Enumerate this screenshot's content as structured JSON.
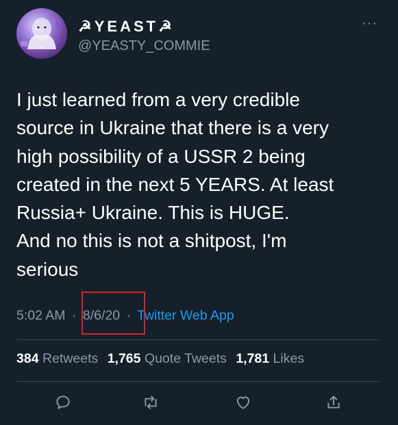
{
  "author": {
    "display_name": "☭YEAST☭",
    "handle": "@YEASTY_COMMIE"
  },
  "tweet": {
    "text": "I just learned from a very credible\nsource in Ukraine that there is a very\nhigh possibility of a USSR 2 being\ncreated in the next 5 YEARS. At least\nRussia+ Ukraine. This is HUGE.\nAnd no this is not a shitpost, I'm\nserious",
    "time": "5:02 AM",
    "separator": "·",
    "date": "8/6/20",
    "source_app": "Twitter Web App"
  },
  "stats": {
    "retweets_count": "384",
    "retweets_label": "Retweets",
    "quote_tweets_count": "1,765",
    "quote_tweets_label": "Quote Tweets",
    "likes_count": "1,781",
    "likes_label": "Likes"
  },
  "icons": {
    "more": "more-dots-icon",
    "reply": "reply-icon",
    "retweet": "retweet-icon",
    "like": "heart-icon",
    "share": "share-icon"
  },
  "colors": {
    "background": "#15202b",
    "secondary_text": "#8b98a5",
    "link": "#1d9bf0",
    "divider": "#38444d",
    "highlight_box": "#e0202a"
  }
}
